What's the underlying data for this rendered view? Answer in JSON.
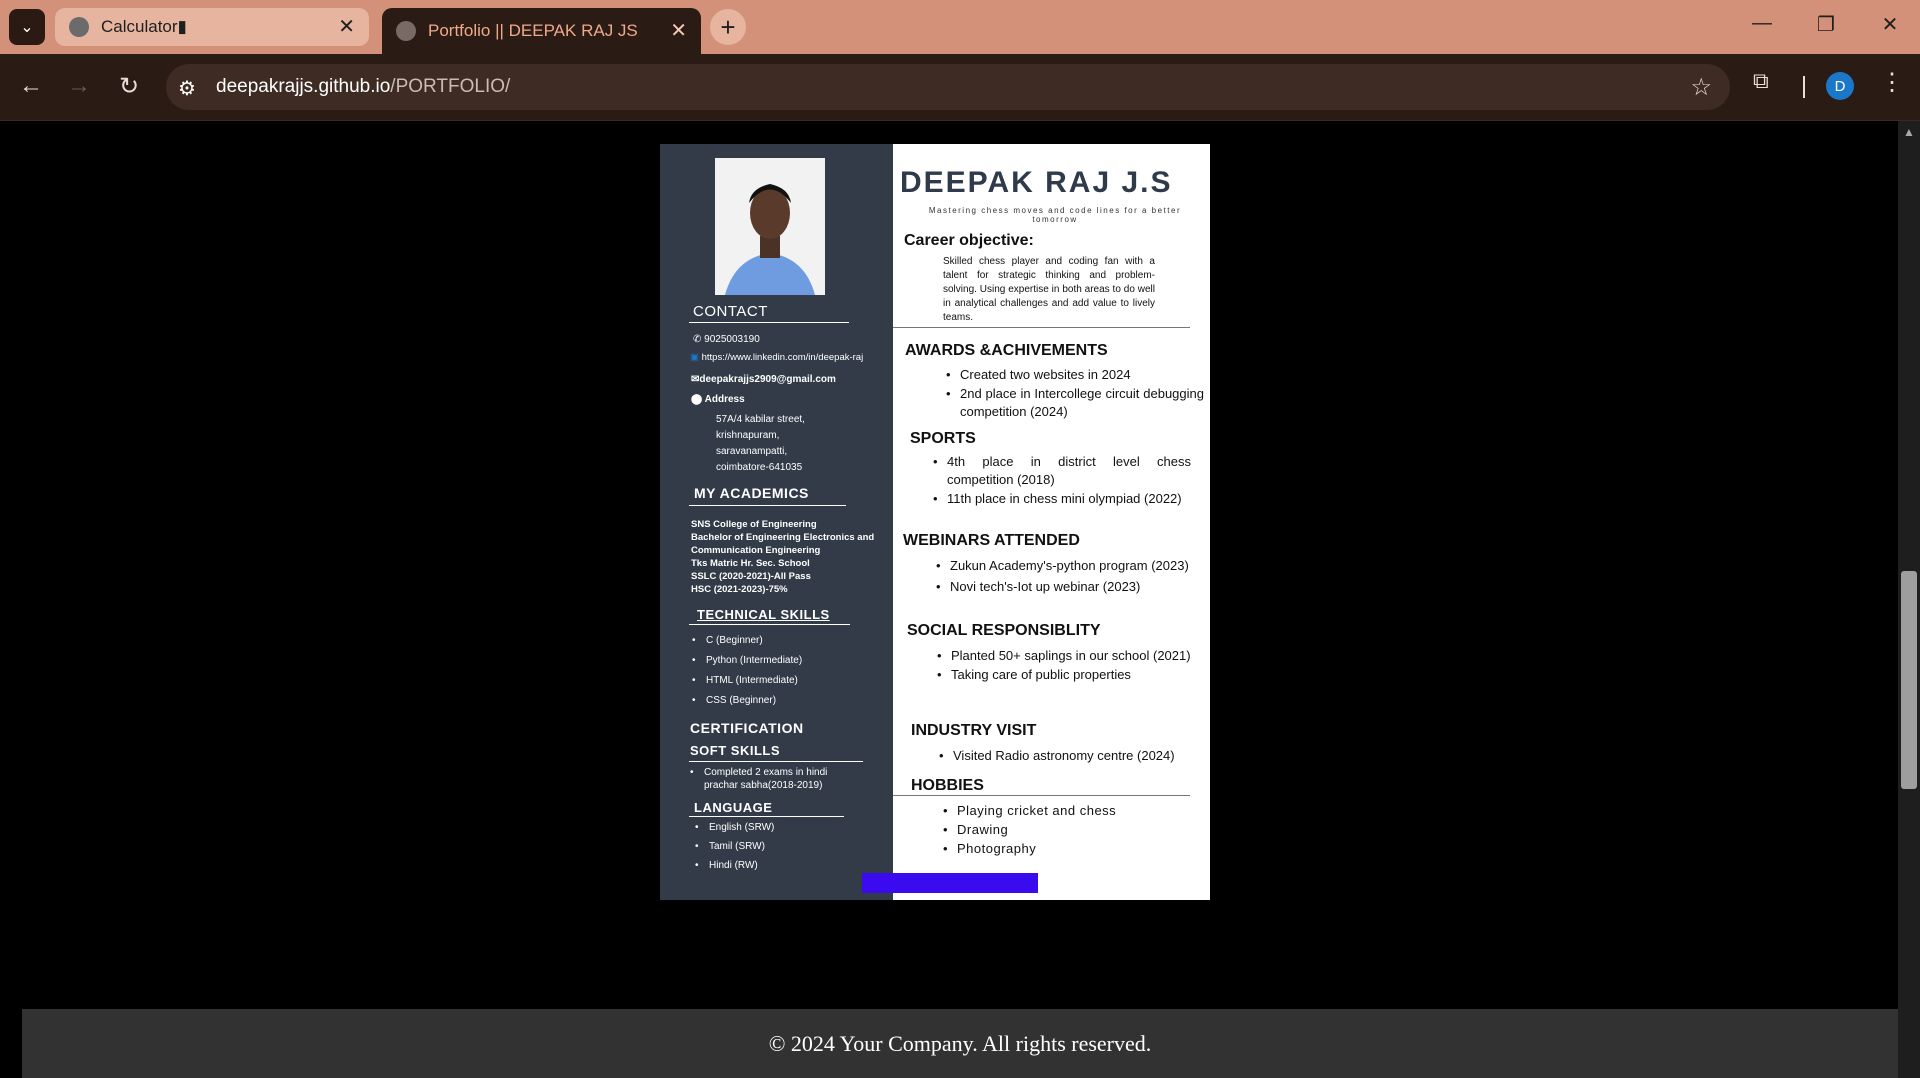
{
  "browser": {
    "tabs": [
      {
        "title": "Calculator▮",
        "active": false
      },
      {
        "title": "Portfolio || DEEPAK RAJ JS",
        "active": true
      }
    ],
    "url_host": "deepakrajjs.github.io",
    "url_path": "/PORTFOLIO/",
    "profile_initial": "D"
  },
  "resume": {
    "name": "DEEPAK RAJ J.S",
    "tagline": "Mastering chess moves and code lines for a better tomorrow",
    "contact": {
      "heading": "CONTACT",
      "phone": "9025003190",
      "linkedin": "https://www.linkedin.com/in/deepak-raj",
      "email": "deepakrajjs2909@gmail.com",
      "address_label": "Address",
      "address_lines": [
        "57A/4 kabilar street,",
        "krishnapuram,",
        "saravanampatti,",
        "coimbatore-641035"
      ]
    },
    "academics": {
      "heading": "MY ACADEMICS",
      "lines": [
        "SNS College of Engineering",
        "Bachelor of Engineering Electronics and",
        "Communication Engineering",
        "Tks Matric Hr. Sec. School",
        "SSLC (2020-2021)-All Pass",
        "HSC (2021-2023)-75%"
      ]
    },
    "technical_skills": {
      "heading": "TECHNICAL SKILLS",
      "items": [
        "C (Beginner)",
        "Python (Intermediate)",
        "HTML (Intermediate)",
        "CSS (Beginner)"
      ]
    },
    "certification_heading": "CERTIFICATION",
    "soft_skills": {
      "heading": "SOFT SKILLS",
      "items": [
        "Completed 2 exams in hindi prachar sabha(2018-2019)"
      ]
    },
    "language": {
      "heading": "LANGUAGE",
      "items": [
        "English (SRW)",
        "Tamil (SRW)",
        "Hindi (RW)"
      ]
    },
    "career": {
      "heading": "Career objective:",
      "text": "Skilled chess player and coding fan with a talent for strategic thinking and problem-solving. Using expertise in both areas to do well in analytical challenges and add value to lively teams."
    },
    "awards": {
      "heading": "AWARDS &ACHIVEMENTS",
      "items": [
        "Created  two websites in 2024",
        "2nd place in Intercollege circuit debugging competition (2024)"
      ]
    },
    "sports": {
      "heading": "SPORTS",
      "items": [
        "4th place in district level chess competition (2018)",
        "11th place in chess mini olympiad (2022)"
      ]
    },
    "webinars": {
      "heading": "WEBINARS ATTENDED",
      "items": [
        "Zukun Academy's-python program (2023)",
        "Novi tech's-Iot up webinar (2023)"
      ]
    },
    "social": {
      "heading": "SOCIAL RESPONSIBLITY",
      "items": [
        "Planted 50+ saplings in our school (2021)",
        "Taking care of public properties"
      ]
    },
    "industry": {
      "heading": "INDUSTRY VISIT",
      "items": [
        "Visited Radio astronomy centre (2024)"
      ]
    },
    "hobbies": {
      "heading": "HOBBIES",
      "items": [
        "Playing cricket and chess",
        "Drawing",
        "Photography"
      ]
    }
  },
  "footer": {
    "text": "© 2024 Your Company. All rights reserved."
  },
  "colors": {
    "tabbar": "#d4917a",
    "toolbar": "#2a1b15",
    "resume_sidebar": "#333b48",
    "purple_button": "#3b0bf0",
    "footer": "#323232"
  }
}
